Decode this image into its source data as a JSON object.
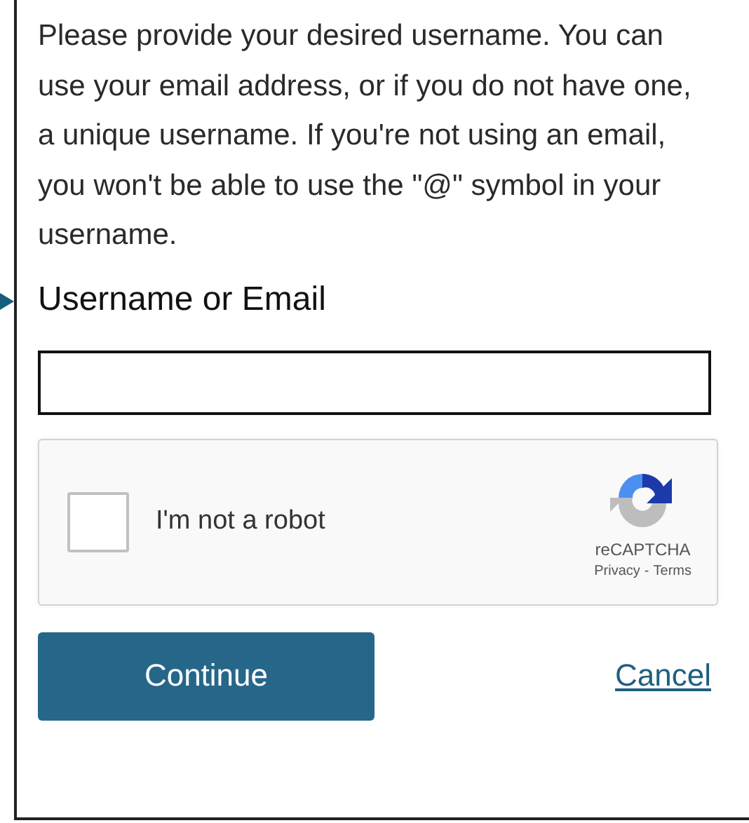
{
  "instructions": "Please provide your desired username. You can use your email address, or if you do not have one, a unique username. If you're not using an email, you won't be able to use the \"@\" symbol in your username.",
  "field": {
    "label": "Username or Email"
  },
  "captcha": {
    "label": "I'm not a robot",
    "checked": false,
    "brand": "reCAPTCHA",
    "privacy": "Privacy",
    "separator": "-",
    "terms": "Terms"
  },
  "actions": {
    "primary": "Continue",
    "cancel": "Cancel"
  }
}
